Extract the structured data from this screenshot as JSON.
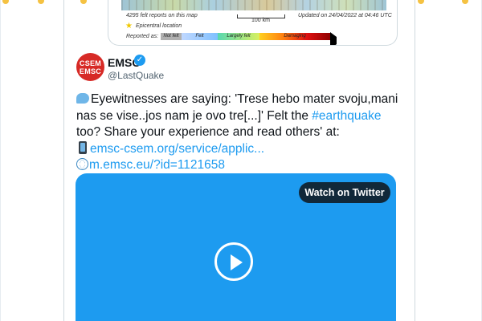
{
  "map_image": {
    "reports_text": "4295 felt reports on this map",
    "scale_text": "100 km",
    "updated_text": "Updated on 24/04/2022 at 04:46 UTC",
    "epicentral_text": "Epicentral location",
    "reported_as_text": "Reported as:",
    "legend": [
      "Not felt",
      "Felt",
      "Largely felt",
      "Damaging"
    ]
  },
  "author": {
    "avatar_line1": "CSEM",
    "avatar_line2": "EMSC",
    "display_name": "EMSC",
    "handle": "@LastQuake",
    "verified_glyph": "✓"
  },
  "tweet": {
    "line1": "Eyewitnesses are saying: 'Trese hebo mater svoju,mani",
    "line2": "nas se vise..jos nam je ovo tre[...]' Felt the ",
    "hashtag": "#earthquake",
    "line3": "too? Share your experience and read others' at:",
    "link1": "emsc-csem.org/service/applic...",
    "link2": "m.emsc.eu/?id=1121658"
  },
  "video": {
    "watch_label": "Watch on Twitter",
    "background": "#1d9bf0"
  },
  "colors": {
    "link": "#1d9bf0",
    "avatar": "#d72a26"
  }
}
